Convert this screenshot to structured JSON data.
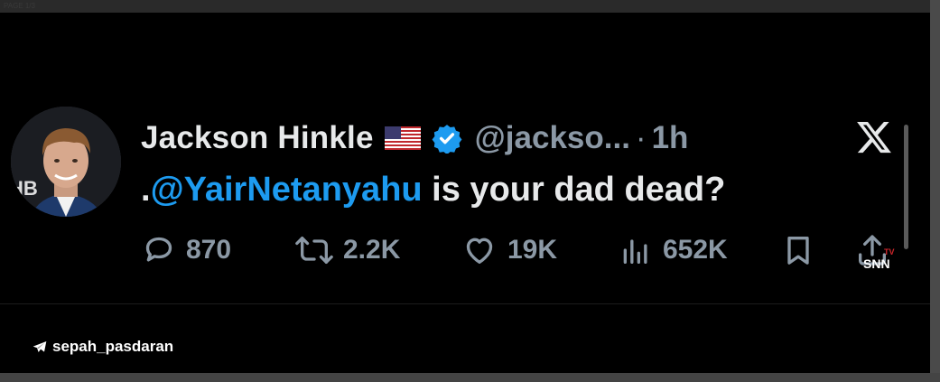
{
  "header_strip_text": "PAGE 1/3",
  "tweet": {
    "author_name": "Jackson Hinkle",
    "author_handle": "@jackso...",
    "separator": "·",
    "time": "1h",
    "text_prefix": ".",
    "mention": "@YairNetanyahu",
    "text_rest": " is your dad dead?"
  },
  "actions": {
    "replies": "870",
    "reposts": "2.2K",
    "likes": "19K",
    "views": "652K"
  },
  "watermark": {
    "snn_text": "SNN",
    "tv_text": "TV"
  },
  "credit": {
    "username": "sepah_pasdaran"
  },
  "icons": {
    "flag": "us-flag-icon",
    "verified": "verified-badge-icon",
    "x": "x-logo-icon",
    "reply": "reply-icon",
    "repost": "repost-icon",
    "like": "heart-icon",
    "views": "views-icon",
    "bookmark": "bookmark-icon",
    "share": "share-icon",
    "telegram": "telegram-icon"
  },
  "colors": {
    "background": "#000000",
    "text": "#e7e9ea",
    "muted": "#8b98a5",
    "accent": "#1d9bf0"
  }
}
